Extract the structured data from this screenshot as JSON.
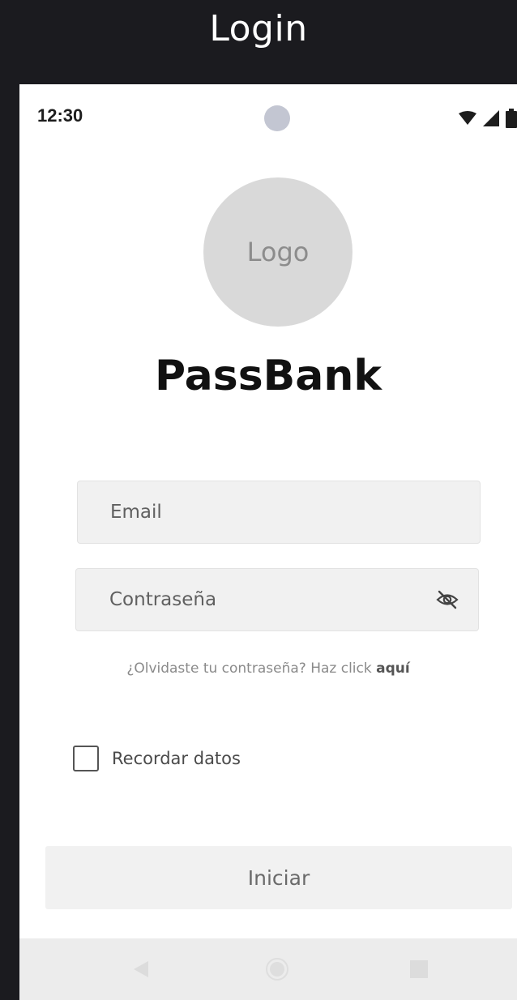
{
  "frame": {
    "title": "Login"
  },
  "status_bar": {
    "time": "12:30"
  },
  "logo": {
    "text": "Logo"
  },
  "app": {
    "name": "PassBank"
  },
  "form": {
    "email_placeholder": "Email",
    "password_placeholder": "Contraseña",
    "forgot_text": "¿Olvidaste tu contraseña? Haz click ",
    "forgot_link": "aquí",
    "remember_label": "Recordar datos",
    "remember_checked": false,
    "submit_label": "Iniciar"
  },
  "icons": {
    "camera": "camera-dot-icon",
    "wifi": "wifi-icon",
    "signal": "cell-signal-icon",
    "battery": "battery-icon",
    "password_toggle": "eye-off-icon",
    "nav_back": "triangle-back-icon",
    "nav_home": "circle-home-icon",
    "nav_recents": "square-recents-icon"
  },
  "colors": {
    "frame_bg": "#1b1b1f",
    "field_bg": "#f1f1f1",
    "logo_bg": "#d9d9d9",
    "nav_bg": "#ececec"
  }
}
